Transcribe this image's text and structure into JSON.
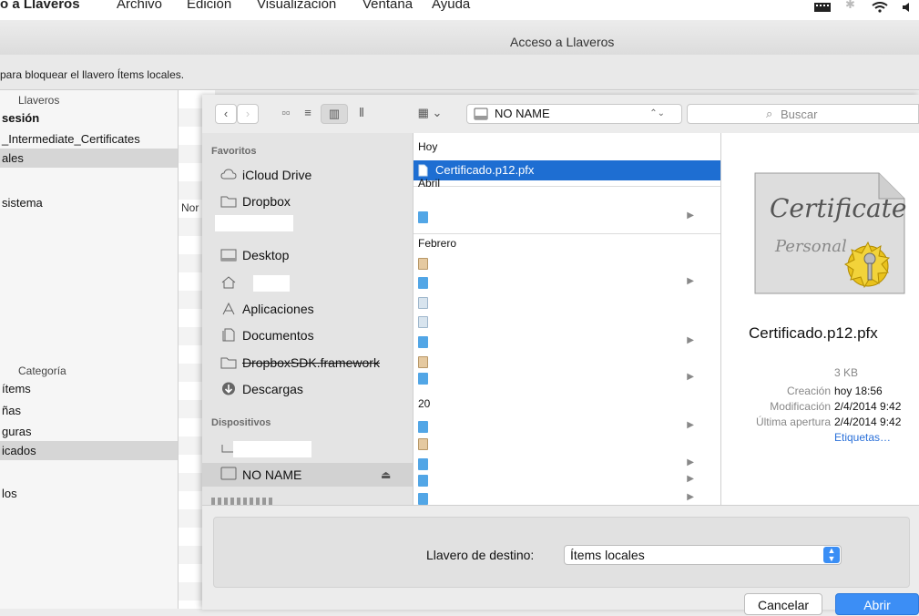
{
  "menubar": {
    "items": [
      "o a Llaveros",
      "Archivo",
      "Edición",
      "Visualización",
      "Ventana",
      "Ayuda"
    ]
  },
  "window": {
    "title": "Acceso a Llaveros",
    "lock_text": "para bloquear el llavero Ítems locales."
  },
  "sidebar": {
    "keychains_header": "Llaveros",
    "keychains": [
      "sesión",
      "_Intermediate_Certificates",
      "ales",
      "sistema"
    ],
    "category_header": "Categoría",
    "categories": [
      "ítems",
      "ñas",
      "guras",
      "icados",
      "los"
    ],
    "column_header_fragment": "Nor"
  },
  "dialog": {
    "toolbar": {
      "location": "NO NAME",
      "search_placeholder": "Buscar"
    },
    "favorites_header": "Favoritos",
    "favorites": [
      "iCloud Drive",
      "Dropbox",
      "",
      "Desktop",
      "",
      "Aplicaciones",
      "Documentos",
      "DropboxSDK.framework",
      "Descargas"
    ],
    "devices_header": "Dispositivos",
    "devices": [
      "",
      "NO NAME"
    ],
    "columns": {
      "sections": [
        "Hoy",
        "Abril",
        "Febrero",
        "20"
      ],
      "selected_file": "Certificado.p12.pfx"
    },
    "preview": {
      "filename": "Certificado.p12.pfx",
      "size": "3 KB",
      "meta": [
        {
          "label": "Creación",
          "value": "hoy 18:56"
        },
        {
          "label": "Modificación",
          "value": "2/4/2014 9:42"
        },
        {
          "label": "Última apertura",
          "value": "2/4/2014 9:42"
        }
      ],
      "tags_link": "Etiquetas…",
      "cert_line1": "Certificate",
      "cert_line2": "Personal"
    },
    "destination": {
      "label": "Llavero de destino:",
      "value": "Ítems locales"
    },
    "buttons": {
      "cancel": "Cancelar",
      "open": "Abrir"
    }
  },
  "colors": {
    "selection_blue": "#1e6ed2",
    "primary_button": "#3c8ef5"
  }
}
